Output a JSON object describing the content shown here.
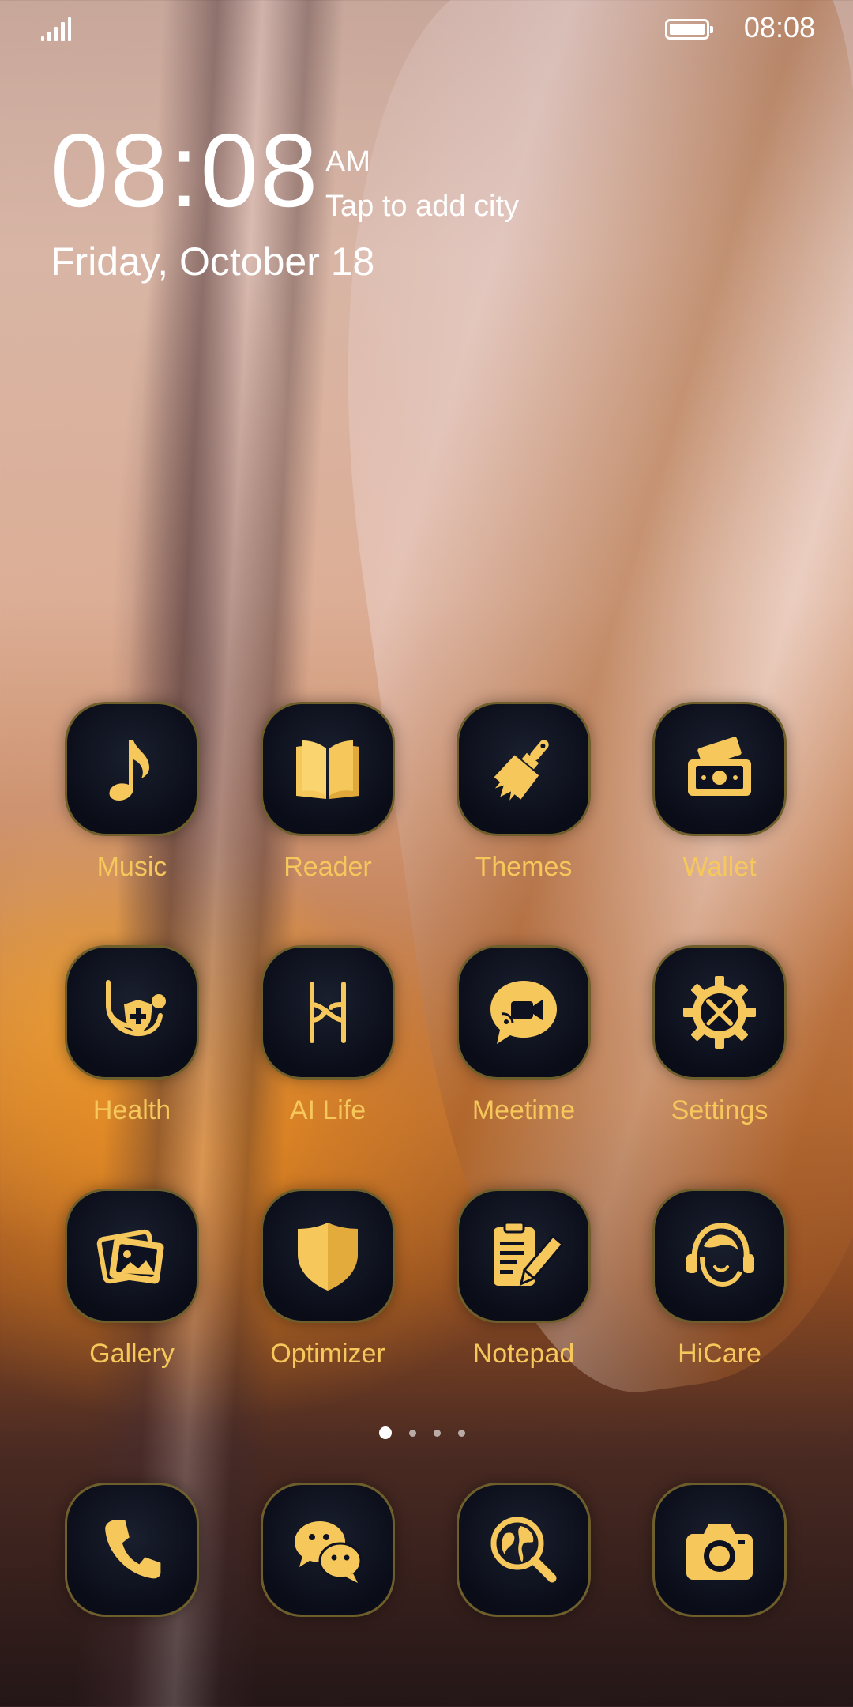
{
  "status_bar": {
    "time": "08:08",
    "battery_level": 1.0
  },
  "clock": {
    "time": "08:08",
    "ampm": "AM",
    "city_prompt": "Tap to add city",
    "date": "Friday, October 18"
  },
  "apps": [
    {
      "label": "Music",
      "icon": "music-note-icon"
    },
    {
      "label": "Reader",
      "icon": "book-icon"
    },
    {
      "label": "Themes",
      "icon": "paintbrush-icon"
    },
    {
      "label": "Wallet",
      "icon": "wallet-icon"
    },
    {
      "label": "Health",
      "icon": "stethoscope-icon"
    },
    {
      "label": "AI Life",
      "icon": "ai-life-icon"
    },
    {
      "label": "Meetime",
      "icon": "video-chat-icon"
    },
    {
      "label": "Settings",
      "icon": "gear-tools-icon"
    },
    {
      "label": "Gallery",
      "icon": "photo-icon"
    },
    {
      "label": "Optimizer",
      "icon": "shield-icon"
    },
    {
      "label": "Notepad",
      "icon": "clipboard-pencil-icon"
    },
    {
      "label": "HiCare",
      "icon": "headset-icon"
    }
  ],
  "page_indicator": {
    "pages": 4,
    "current": 1
  },
  "dock": [
    {
      "icon": "phone-icon"
    },
    {
      "icon": "chat-bubbles-icon"
    },
    {
      "icon": "globe-search-icon"
    },
    {
      "icon": "camera-icon"
    }
  ],
  "colors": {
    "icon_gold": "#f6c85c",
    "tile_bg": "#0d1120",
    "tile_border": "#6e5e2c"
  }
}
